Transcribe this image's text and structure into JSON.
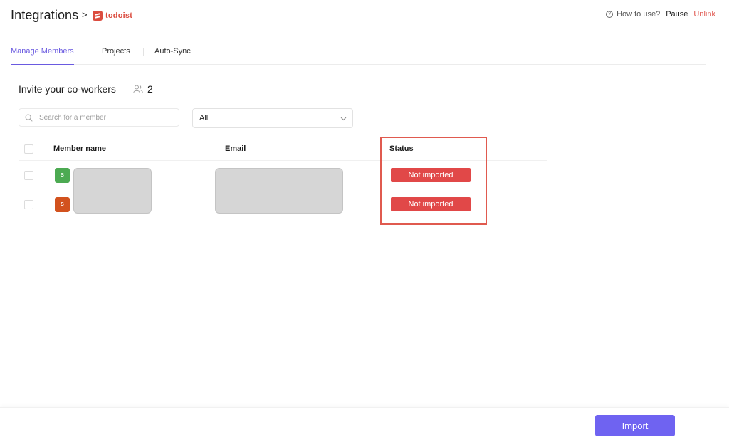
{
  "header": {
    "title": "Integrations",
    "separator": ">",
    "app_logo_text": "todoist",
    "how_to_use": "How to use?",
    "pause": "Pause",
    "unlink": "Unlink"
  },
  "tabs": [
    {
      "label": "Manage Members",
      "active": true
    },
    {
      "label": "Projects",
      "active": false
    },
    {
      "label": "Auto-Sync",
      "active": false
    }
  ],
  "section": {
    "title": "Invite your co-workers",
    "member_count": "2"
  },
  "search": {
    "placeholder": "Search for a member",
    "value": ""
  },
  "filter": {
    "selected": "All"
  },
  "table": {
    "columns": [
      "Member name",
      "Email",
      "Status"
    ],
    "rows": [
      {
        "avatar_letter": "S",
        "avatar_color": "#4caa52",
        "status": "Not imported"
      },
      {
        "avatar_letter": "S",
        "avatar_color": "#d2521e",
        "status": "Not imported"
      }
    ]
  },
  "footer": {
    "import_label": "Import"
  },
  "colors": {
    "accent": "#6a5ae0",
    "button": "#6f63f1",
    "status_red": "#e14848",
    "todoist_red": "#db4c3f",
    "highlight": "#e05a4f"
  },
  "icons": {
    "help": "help-circle-icon",
    "users": "users-icon",
    "search": "search-icon",
    "chevron": "chevron-down-icon",
    "app_logo": "todoist-logo-icon"
  }
}
